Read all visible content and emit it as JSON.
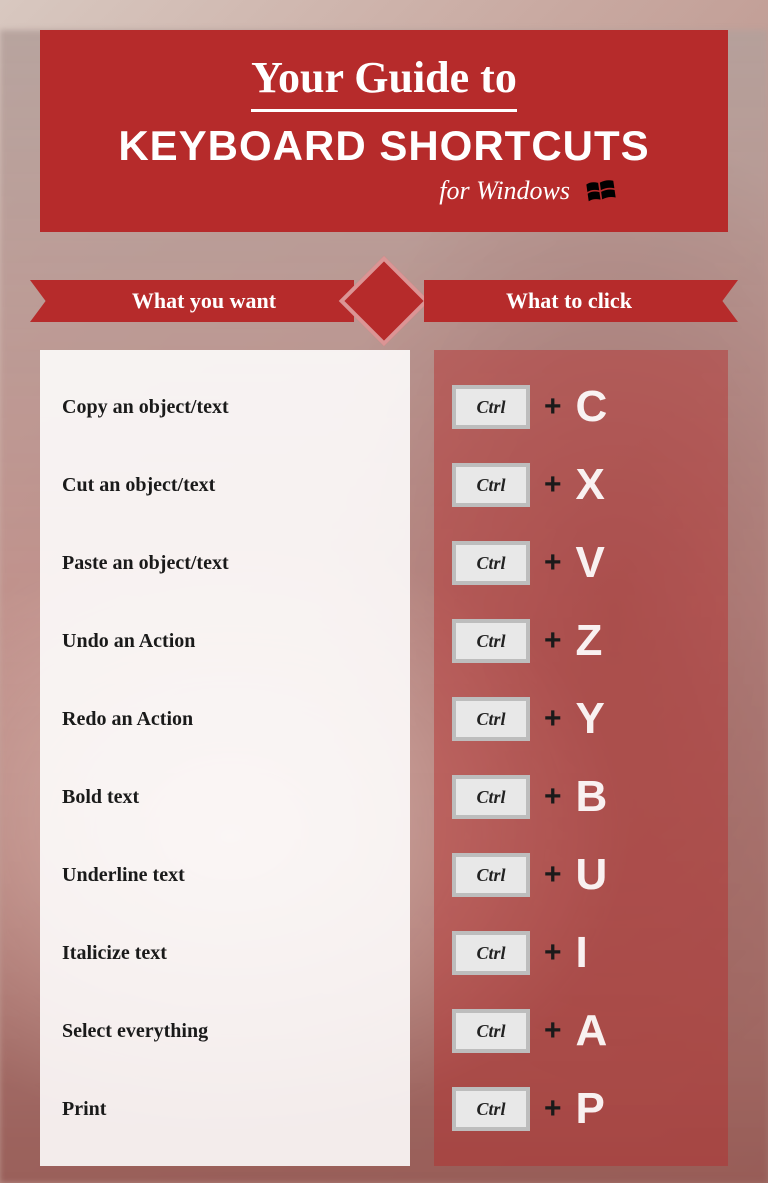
{
  "header": {
    "line1": "Your Guide to",
    "line2": "KEYBOARD SHORTCUTS",
    "subtitle": "for Windows"
  },
  "ribbons": {
    "left": "What you want",
    "right": "What to click"
  },
  "modifier_key": "Ctrl",
  "plus_symbol": "+",
  "shortcuts": [
    {
      "action": "Copy an object/text",
      "key": "C"
    },
    {
      "action": "Cut an object/text",
      "key": "X"
    },
    {
      "action": "Paste an object/text",
      "key": "V"
    },
    {
      "action": "Undo an Action",
      "key": "Z"
    },
    {
      "action": "Redo an Action",
      "key": "Y"
    },
    {
      "action": "Bold text",
      "key": "B"
    },
    {
      "action": "Underline text",
      "key": "U"
    },
    {
      "action": "Italicize text",
      "key": "I"
    },
    {
      "action": "Select everything",
      "key": "A"
    },
    {
      "action": "Print",
      "key": "P"
    }
  ]
}
